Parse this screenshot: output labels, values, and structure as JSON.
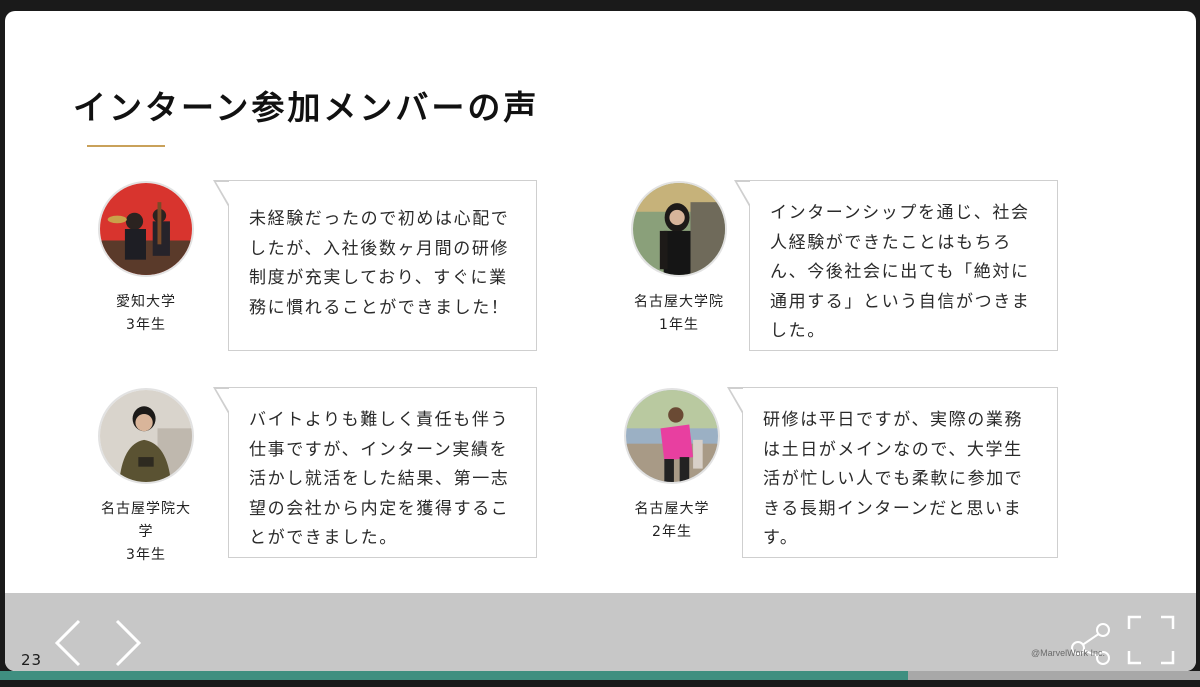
{
  "slide": {
    "title": "インターン参加メンバーの声"
  },
  "testimonials": [
    {
      "school": "愛知大学",
      "year": "3年生",
      "lines": [
        "未経験だったので初めは心配で",
        "したが、入社後数ヶ月間の研修",
        "制度が充実しており、すぐに業",
        "務に慣れることができました！"
      ]
    },
    {
      "school": "名古屋大学院",
      "year": "1年生",
      "lines": [
        "インターンシップを通じ、社会",
        "人経験ができたことはもちろ",
        "ん、今後社会に出ても「絶対に",
        "通用する」という自信がつきま",
        "した。"
      ]
    },
    {
      "school": "名古屋学院大学",
      "year": "3年生",
      "lines": [
        "バイトよりも難しく責任も伴う",
        "仕事ですが、インターン実績を",
        "活かし就活をした結果、第一志",
        "望の会社から内定を獲得するこ",
        "とができました。"
      ]
    },
    {
      "school": "名古屋大学",
      "year": "2年生",
      "lines": [
        "研修は平日ですが、実際の業務",
        "は土日がメインなので、大学生",
        "活が忙しい人でも柔軟に参加で",
        "きる長期インターンだと思いま",
        "す。"
      ]
    }
  ],
  "viewer": {
    "page_number": "23",
    "copyright": "@MarvelWork Inc.",
    "progress": 0.757,
    "icons": {
      "prev": "chevron-left-icon",
      "next": "chevron-right-icon",
      "share": "share-icon",
      "fullscreen": "fullscreen-icon"
    }
  },
  "colors": {
    "accent_rule": "#c9a15a",
    "progress": "#3f8f80",
    "bottom_bar": "#c7c7c7"
  }
}
